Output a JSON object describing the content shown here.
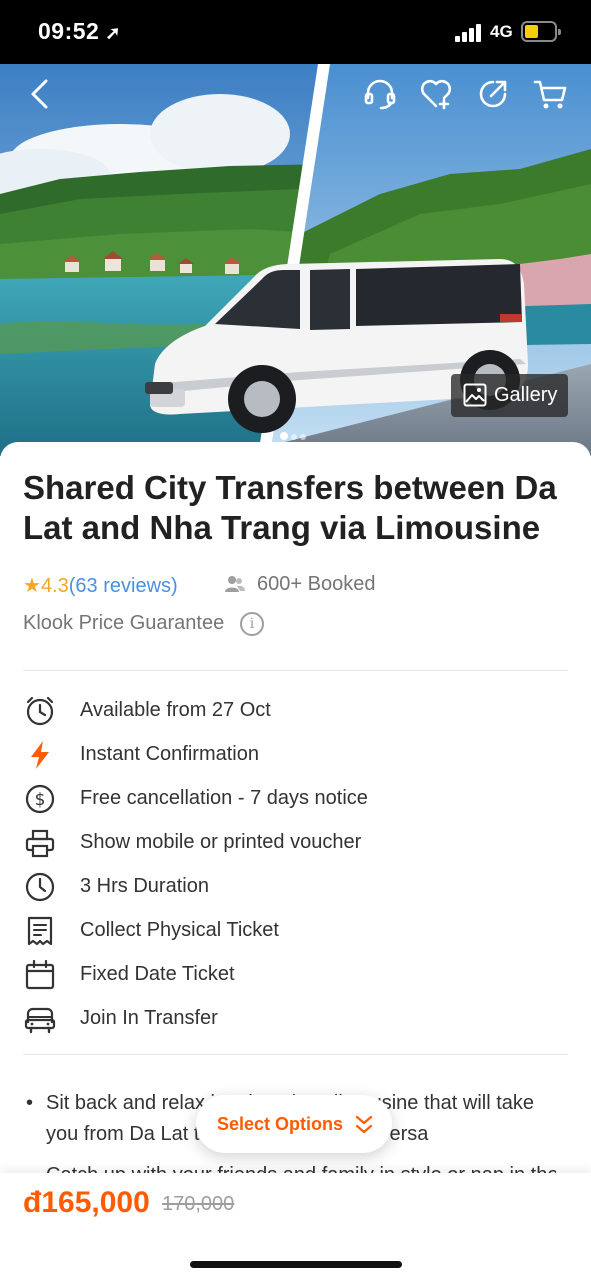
{
  "status_bar": {
    "time": "09:52",
    "network": "4G"
  },
  "hero": {
    "gallery_label": "Gallery",
    "slide_count": 3,
    "active_slide": 1
  },
  "product": {
    "title": "Shared City Transfers between Da Lat and Nha Trang via Limousine",
    "rating_star": "★",
    "rating": "4.3",
    "reviews": "(63 reviews)",
    "booked": "600+ Booked",
    "guarantee": "Klook Price Guarantee"
  },
  "features": [
    {
      "icon": "alarm-clock-icon",
      "label": "Available from 27 Oct"
    },
    {
      "icon": "lightning-icon",
      "label": "Instant Confirmation"
    },
    {
      "icon": "dollar-circle-icon",
      "label": "Free cancellation - 7 days notice"
    },
    {
      "icon": "printer-icon",
      "label": "Show mobile or printed voucher"
    },
    {
      "icon": "clock-icon",
      "label": "3 Hrs Duration"
    },
    {
      "icon": "receipt-icon",
      "label": "Collect Physical Ticket"
    },
    {
      "icon": "calendar-icon",
      "label": "Fixed Date Ticket"
    },
    {
      "icon": "bus-icon",
      "label": "Join In Transfer"
    }
  ],
  "description": {
    "bullet": "•",
    "line1": "Sit back and relax in a luxurious limousine that will take you from Da Lat to Nha Trang or vice versa",
    "line2": "Catch up with your friends and family in style or nap in the"
  },
  "select_options": {
    "label": "Select Options"
  },
  "pricing": {
    "price": "đ165,000",
    "original_price": "170,000"
  },
  "colors": {
    "accent": "#ff5b00",
    "star": "#f5a623",
    "link": "#4a90e2"
  }
}
